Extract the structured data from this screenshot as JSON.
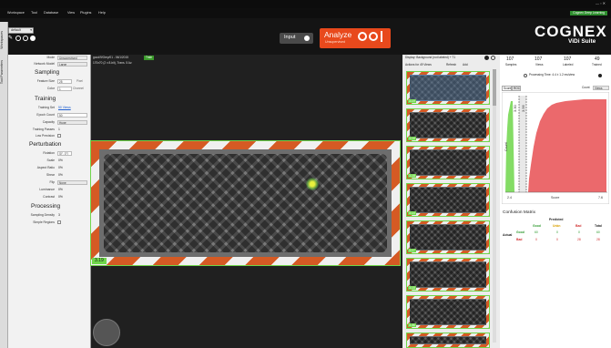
{
  "window": {
    "controls": "— ▫ ✕",
    "suite_label": "Cognex Deep Learning"
  },
  "menu": [
    "Workspace",
    "Tool",
    "Database",
    "View",
    "Plugins",
    "Help"
  ],
  "toolbar": {
    "workspace_value": "default",
    "input_label": "Input",
    "analyze_label": "Analyze",
    "analyze_sub": "Unsupervised",
    "brand": "COGNEX",
    "brand_sub": "ViDi Suite"
  },
  "sidebar": {
    "vertical_tabs": [
      "Workspaces",
      "Tool Parameters"
    ],
    "mode": {
      "label": "Mode",
      "value": "Unsupervised"
    },
    "network_model": {
      "label": "Network Model",
      "value": "Large"
    },
    "sampling": {
      "title": "Sampling",
      "feature_size": {
        "label": "Feature Size",
        "value": "25",
        "unit": "Pixel"
      },
      "color": {
        "label": "Color",
        "value": "1",
        "unit": "Channel"
      }
    },
    "training": {
      "title": "Training",
      "training_set": {
        "label": "Training Set",
        "value": "50 Views"
      },
      "epoch_count": {
        "label": "Epoch Count",
        "value": "50"
      },
      "capacity": {
        "label": "Capacity",
        "value": "Huge"
      },
      "training_passes": {
        "label": "Training Passes",
        "value": "1"
      },
      "low_precision": {
        "label": "Low Precision"
      }
    },
    "perturbation": {
      "title": "Perturbation",
      "rotation": {
        "label": "Rotation",
        "value": "[0°, 0°]"
      },
      "scale": {
        "label": "Scale",
        "value": "0%"
      },
      "aspect_ratio": {
        "label": "Aspect Ratio",
        "value": "0%"
      },
      "shear": {
        "label": "Shear",
        "value": "0%"
      },
      "flip": {
        "label": "Flip",
        "value": "None"
      },
      "luminance": {
        "label": "Luminance",
        "value": "0%"
      },
      "contrast": {
        "label": "Contrast",
        "value": "0%"
      }
    },
    "processing": {
      "title": "Processing",
      "sampling_density": {
        "label": "Sampling Density",
        "value": "3"
      },
      "simple_regions": {
        "label": "Simple Regions"
      }
    }
  },
  "viewer": {
    "info_line1": "good/9/Grey/01 - 06/1/2015",
    "info_badge": "Train",
    "info_line2": "170x70 (2 x 8-bit), Trans. 5 Av.",
    "score": "3.19"
  },
  "thumbs": {
    "display_label": "Display: Background (not labeled) + T1",
    "actions_label": "Actions for 49 Views",
    "refresh": "Refresh",
    "add": "Add",
    "scores": [
      "3.19",
      "3.16",
      "3.18",
      "3.14",
      "3.17",
      "3.15",
      "3.06",
      "3.14"
    ]
  },
  "stats": {
    "columns": [
      {
        "value": "107",
        "label": "Samples"
      },
      {
        "value": "107",
        "label": "Views"
      },
      {
        "value": "107",
        "label": "Labeled"
      },
      {
        "value": "49",
        "label": "Trained"
      }
    ],
    "processing_time": "Processing Time: 4.4 ± 1.2 ms/view",
    "tabs": [
      "Score",
      "ROC"
    ],
    "count_label": "Count",
    "views_select": "Views",
    "threshold_low": "3.30",
    "threshold_high": "3.56",
    "hist_ylabel": "Count",
    "hist_xlabel": "Score",
    "hist_xmin": "2.4",
    "hist_xmax": "7.6",
    "confusion": {
      "title": "Confusion Matrix",
      "predicted": "Predicted",
      "actual": "Actual",
      "col_headers": [
        "Good",
        "Unkn",
        "Bad",
        "Total"
      ],
      "rows": [
        {
          "label": "Good",
          "values": [
            "60",
            "0",
            "0",
            "60"
          ]
        },
        {
          "label": "Bad",
          "values": [
            "0",
            "0",
            "28",
            "28"
          ]
        }
      ]
    }
  },
  "colors": {
    "accent_orange": "#e8491c",
    "good_green": "#6fd64a",
    "bad_red": "#e9595c"
  }
}
